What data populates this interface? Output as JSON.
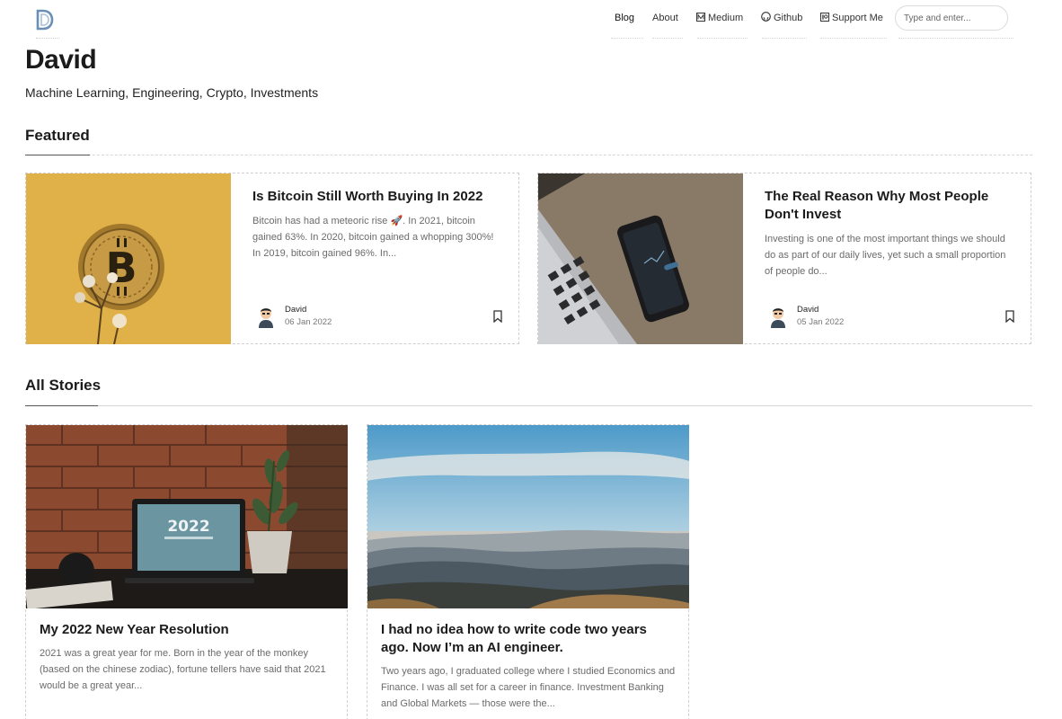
{
  "nav": {
    "items": [
      {
        "label": "Blog"
      },
      {
        "label": "About"
      },
      {
        "label": "Medium"
      },
      {
        "label": "Github"
      },
      {
        "label": "Support Me"
      }
    ],
    "search_placeholder": "Type and enter..."
  },
  "site": {
    "title": "David",
    "description": "Machine Learning, Engineering, Crypto, Investments"
  },
  "sections": {
    "featured": "Featured",
    "all_stories": "All Stories"
  },
  "featured": [
    {
      "title": "Is Bitcoin Still Worth Buying In 2022",
      "excerpt": "Bitcoin has had a meteoric rise 🚀. In 2021, bitcoin gained 63%. In 2020, bitcoin gained a whopping 300%! In 2019, bitcoin gained 96%. In...",
      "author": "David",
      "date": "06 Jan 2022"
    },
    {
      "title": "The Real Reason Why Most People Don't Invest",
      "excerpt": "Investing is one of the most important things we should do as part of our daily lives, yet such a small proportion of people do...",
      "author": "David",
      "date": "05 Jan 2022"
    }
  ],
  "stories": [
    {
      "title": "My 2022 New Year Resolution",
      "excerpt": "2021 was a great year for me. Born in the year of the monkey (based on the chinese zodiac), fortune tellers have said that 2021 would be a great year...",
      "image_text": "2022"
    },
    {
      "title": "I had no idea how to write code two years ago. Now I’m an AI engineer.",
      "excerpt": "Two years ago, I graduated college where I studied Economics and Finance. I was all set for a career in finance. Investment Banking and Global Markets — those were the..."
    }
  ],
  "colors": {
    "bitcoin_bg": "#e3b54e",
    "accent_logo": "#6a8fb5"
  },
  "icons": {
    "logo": "logo-d-icon",
    "medium": "medium-icon",
    "github": "github-icon",
    "support": "patreon-icon",
    "bookmark": "bookmark-icon"
  }
}
